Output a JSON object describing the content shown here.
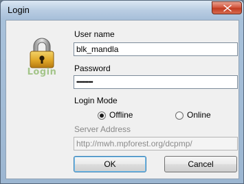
{
  "window": {
    "title": "Login"
  },
  "branding": {
    "caption": "Login"
  },
  "form": {
    "username_label": "User name",
    "username_value": "blk_mandla",
    "password_label": "Password",
    "password_value": "•••••••••••",
    "login_mode_label": "Login Mode",
    "mode_options": [
      {
        "label": "Offline",
        "selected": true
      },
      {
        "label": "Online",
        "selected": false
      }
    ],
    "server_label": "Server Address",
    "server_value": "http://mwh.mpforest.org/dcpmp/"
  },
  "buttons": {
    "ok": "OK",
    "cancel": "Cancel"
  },
  "colors": {
    "accent": "#a4c58a",
    "close": "#c8452b"
  }
}
